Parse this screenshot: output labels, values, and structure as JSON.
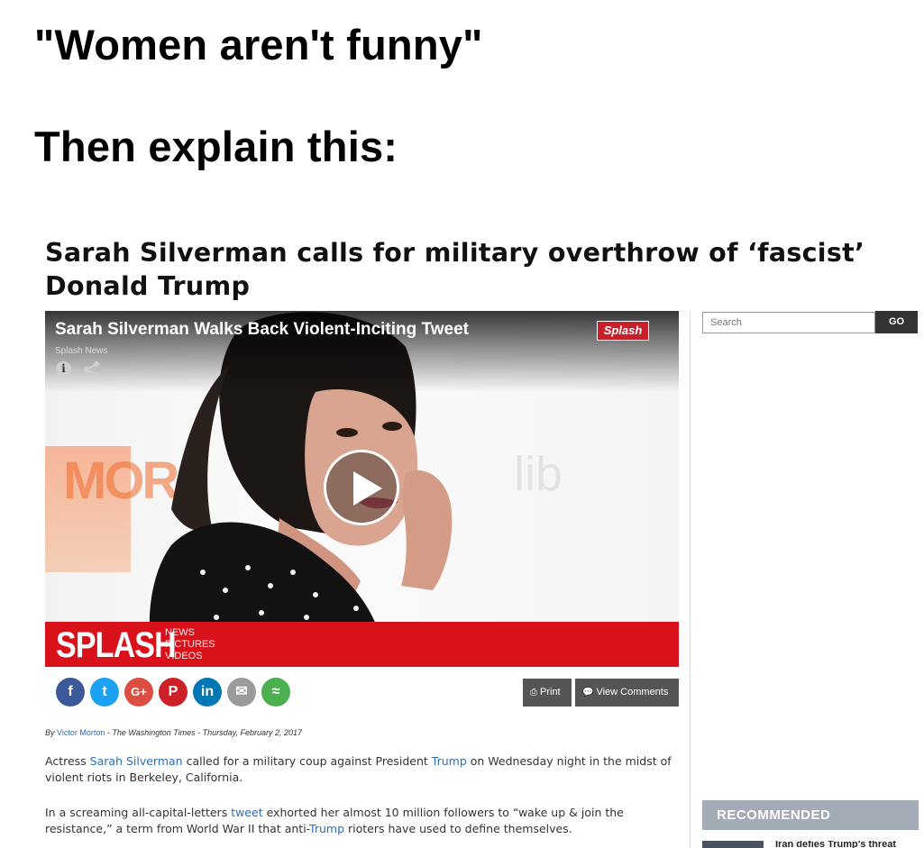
{
  "meme": {
    "line1": "\"Women aren't funny\"",
    "line2": "Then explain this:"
  },
  "article": {
    "headline": "Sarah Silverman calls for military overthrow of ‘fascist’ Donald Trump",
    "byline": {
      "prefix": "By ",
      "author": "Victor Morton",
      "rest": " - The Washington Times - Thursday, February 2, 2017"
    },
    "paragraph1": {
      "t1": "Actress ",
      "l1": "Sarah Silverman",
      "t2": " called for a military coup against President ",
      "l2": "Trump",
      "t3": " on Wednesday night in the midst of violent riots in Berkeley, California."
    },
    "paragraph2": {
      "t1": "In a screaming all-capital-letters ",
      "l1": "tweet",
      "t2": " exhorted her almost 10 million followers to “wake up & join the resistance,” a term from World War II that anti-",
      "l2": "Trump",
      "t3": " rioters have used to define themselves."
    }
  },
  "video": {
    "title": "Sarah Silverman Walks Back Violent-Inciting Tweet",
    "source": "Splash News",
    "badge": "Splash",
    "brand": "SPLASH",
    "brand_sub1": "NEWS",
    "brand_sub2": "PICTURES",
    "brand_sub3": "VIDEOS",
    "wall_text1": "MOR",
    "wall_text2": "lib"
  },
  "share": {
    "facebook": "f",
    "twitter": "t",
    "googleplus": "G+",
    "pinterest": "P",
    "linkedin": "in",
    "email": "✉",
    "sharethis": "≈"
  },
  "actions": {
    "print": "Print",
    "comments": "View Comments"
  },
  "sidebar": {
    "search_placeholder": "Search",
    "go": "GO",
    "recommended": "RECOMMENDED",
    "reco_title": "Iran defies Trump's threat"
  },
  "colors": {
    "accent_red": "#d8111b",
    "link_blue": "#2a6ebb",
    "button_gray": "#555555",
    "reco_bar": "#a3abb6"
  }
}
